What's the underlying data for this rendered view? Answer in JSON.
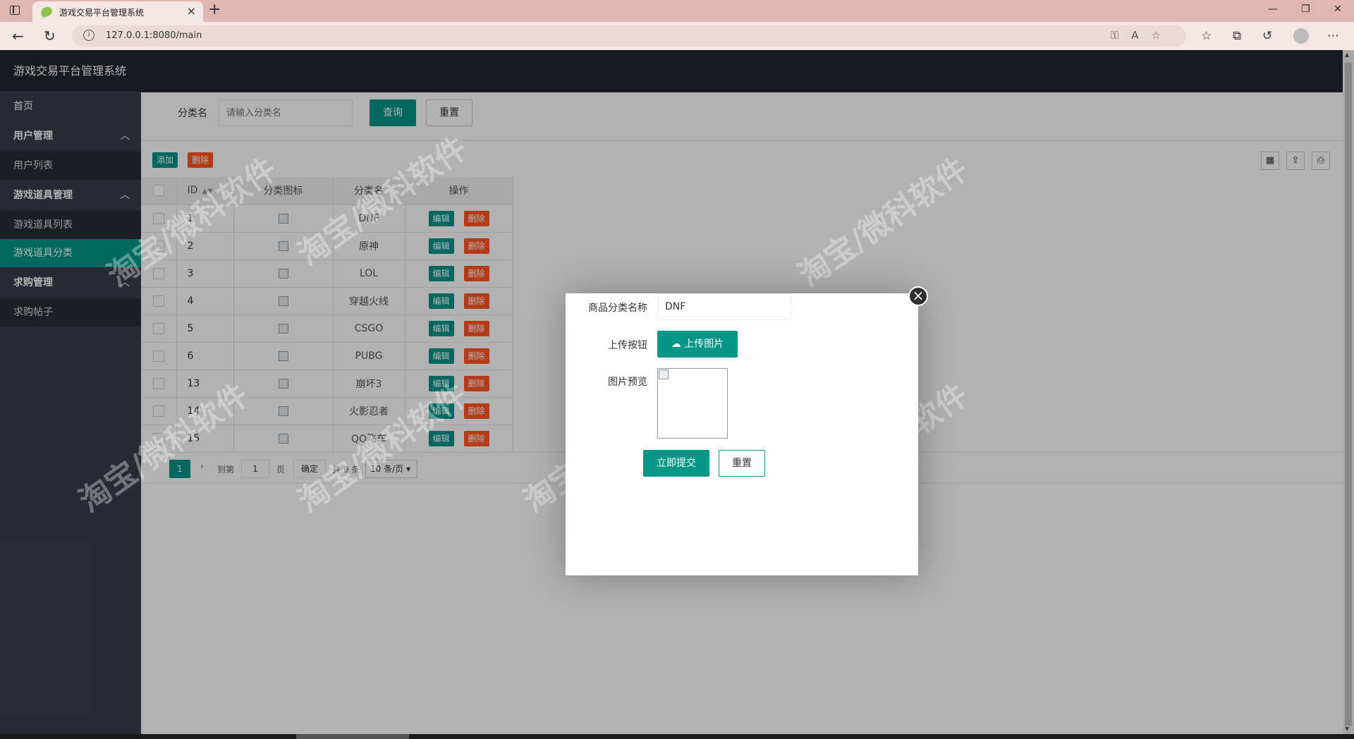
{
  "browser": {
    "tab_title": "游戏交易平台管理系统",
    "url": "127.0.0.1:8080/main"
  },
  "app": {
    "logo": "游戏交易平台管理系统",
    "nav": {
      "home": "首页",
      "groups": [
        {
          "label": "用户管理",
          "children": [
            "用户列表"
          ]
        },
        {
          "label": "游戏道具管理",
          "children": [
            "游戏道具列表",
            "游戏道具分类"
          ]
        },
        {
          "label": "求购管理",
          "children": [
            "求购帖子"
          ]
        }
      ]
    }
  },
  "search": {
    "label": "分类名",
    "placeholder": "请输入分类名",
    "query_label": "查询",
    "reset_label": "重置"
  },
  "toolbar": {
    "add_label": "添加",
    "delete_label": "删除"
  },
  "table": {
    "headers": [
      "ID",
      "分类图标",
      "分类名",
      "操作"
    ],
    "edit_label": "编辑",
    "delete_label": "删除",
    "rows": [
      {
        "id": "1",
        "name": "DNF"
      },
      {
        "id": "2",
        "name": "原神"
      },
      {
        "id": "3",
        "name": "LOL"
      },
      {
        "id": "4",
        "name": "穿越火线"
      },
      {
        "id": "5",
        "name": "CSGO"
      },
      {
        "id": "6",
        "name": "PUBG"
      },
      {
        "id": "13",
        "name": "崩坏3"
      },
      {
        "id": "14",
        "name": "火影忍者"
      },
      {
        "id": "15",
        "name": "QQ飞车"
      }
    ]
  },
  "pager": {
    "current": "1",
    "goto_label": "到第",
    "page_input": "1",
    "page_unit": "页",
    "confirm_label": "确定",
    "total": "共 9 条",
    "page_size": "10 条/页"
  },
  "modal": {
    "name_label": "商品分类名称",
    "name_value": "DNF",
    "upload_label": "上传按钮",
    "upload_button": "上传图片",
    "preview_label": "图片预览",
    "submit_label": "立即提交",
    "reset_label": "重置"
  },
  "watermark": "淘宝/微科软件",
  "colors": {
    "primary": "#009688",
    "danger": "#ff5722",
    "sidebar": "#393d49",
    "header": "#23262e"
  }
}
